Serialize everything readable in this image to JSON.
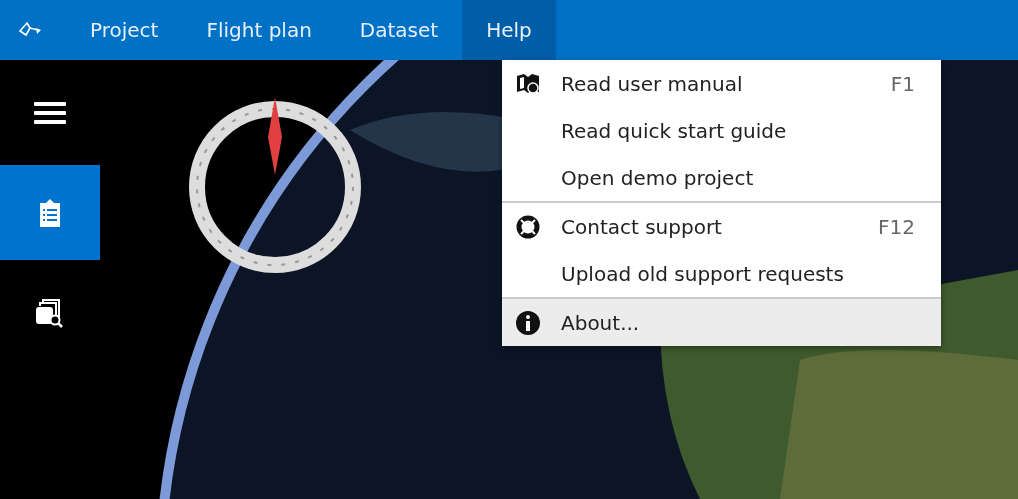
{
  "menubar": {
    "items": [
      {
        "label": "Project",
        "selected": false
      },
      {
        "label": "Flight plan",
        "selected": false
      },
      {
        "label": "Dataset",
        "selected": false
      },
      {
        "label": "Help",
        "selected": true
      }
    ]
  },
  "sidebar": {
    "items": [
      {
        "selected": false
      },
      {
        "selected": true
      },
      {
        "selected": false
      }
    ]
  },
  "help_menu": {
    "sections": [
      [
        {
          "label": "Read user manual",
          "shortcut": "F1",
          "selected": false
        },
        {
          "label": "Read quick start guide",
          "selected": false
        },
        {
          "label": "Open demo project",
          "selected": false
        }
      ],
      [
        {
          "label": "Contact support",
          "shortcut": "F12",
          "selected": false
        },
        {
          "label": "Upload old support requests",
          "selected": false
        }
      ],
      [
        {
          "label": "About...",
          "selected": true
        }
      ]
    ]
  }
}
